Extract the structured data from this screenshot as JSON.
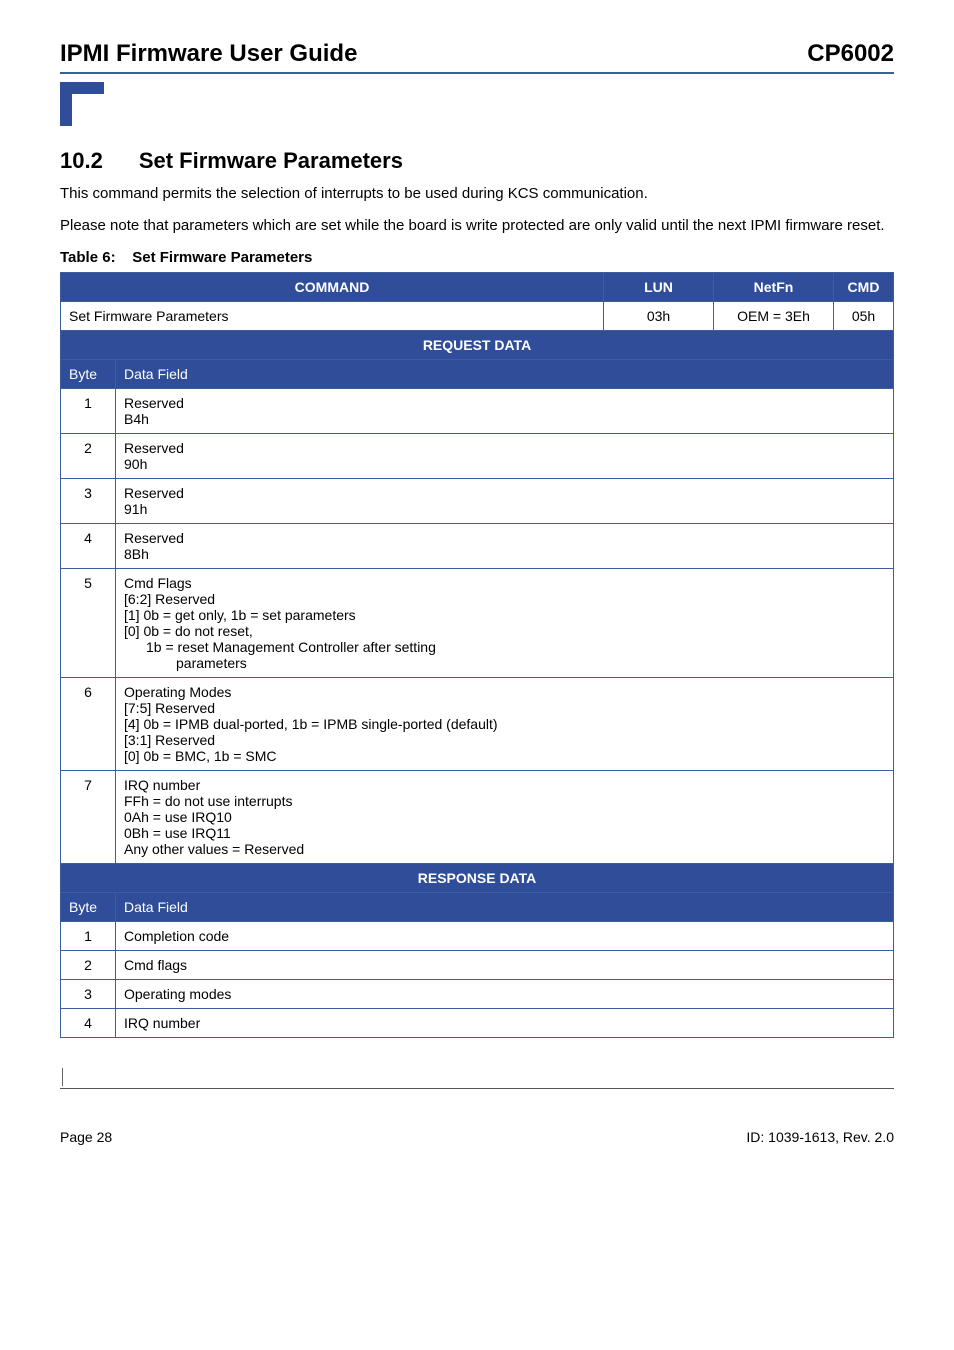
{
  "header": {
    "title": "IPMI Firmware User Guide",
    "product": "CP6002"
  },
  "section": {
    "number": "10.2",
    "title": "Set Firmware Parameters",
    "para1": "This command permits the selection of interrupts to be used during KCS communication.",
    "para2": "Please note that parameters which are set while the board is write protected are only valid until the next IPMI firmware reset."
  },
  "table": {
    "caption_label": "Table 6:",
    "caption_title": "Set Firmware Parameters",
    "head": {
      "command": "COMMAND",
      "lun": "LUN",
      "netfn": "NetFn",
      "cmd": "CMD"
    },
    "cmdrow": {
      "name": "Set Firmware Parameters",
      "lun": "03h",
      "netfn": "OEM = 3Eh",
      "cmd": "05h"
    },
    "request_label": "REQUEST DATA",
    "byte_label": "Byte",
    "datafield_label": "Data Field",
    "request_rows": [
      {
        "byte": "1",
        "lines": [
          "Reserved",
          "B4h"
        ]
      },
      {
        "byte": "2",
        "lines": [
          "Reserved",
          "90h"
        ]
      },
      {
        "byte": "3",
        "lines": [
          "Reserved",
          "91h"
        ]
      },
      {
        "byte": "4",
        "lines": [
          "Reserved",
          "8Bh"
        ]
      },
      {
        "byte": "5",
        "lines": [
          "Cmd Flags",
          "[6:2] Reserved",
          "[1] 0b = get only, 1b = set parameters",
          "[0] 0b = do not reset,"
        ],
        "extra_indent1": "1b = reset Management Controller after setting",
        "extra_indent2": "parameters"
      },
      {
        "byte": "6",
        "lines": [
          "Operating Modes",
          "[7:5] Reserved",
          "[4] 0b = IPMB dual-ported, 1b = IPMB single-ported (default)",
          "[3:1] Reserved",
          "[0] 0b = BMC, 1b = SMC"
        ]
      },
      {
        "byte": "7",
        "lines": [
          "IRQ number",
          "FFh = do not use interrupts",
          "0Ah = use IRQ10",
          "0Bh = use IRQ11",
          "Any other values = Reserved"
        ]
      }
    ],
    "response_label": "RESPONSE DATA",
    "response_rows": [
      {
        "byte": "1",
        "field": "Completion code"
      },
      {
        "byte": "2",
        "field": "Cmd flags"
      },
      {
        "byte": "3",
        "field": "Operating modes"
      },
      {
        "byte": "4",
        "field": "IRQ number"
      }
    ]
  },
  "footer": {
    "page": "Page 28",
    "id": "ID: 1039-1613, Rev. 2.0"
  }
}
